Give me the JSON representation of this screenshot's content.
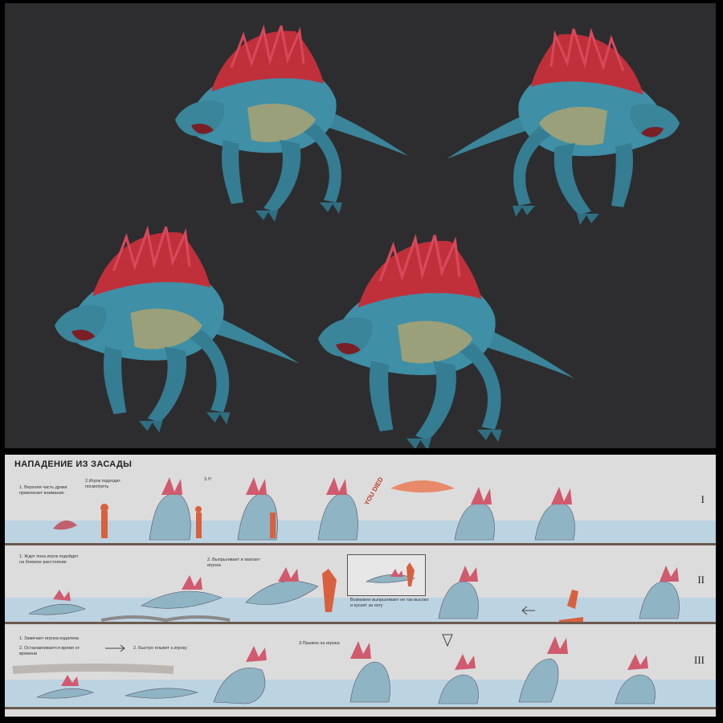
{
  "board": {
    "title": "НАПАДЕНИЕ ИЗ ЗАСАДЫ",
    "rows": [
      {
        "numeral": "I",
        "notes": [
          "1. Верхняя часть драки привлекает внимание",
          "2.Игрок подходит посмотреть",
          "3.!!!",
          "YOU DIED"
        ]
      },
      {
        "numeral": "II",
        "notes": [
          "1. Ждет пока игрок подойдет на близкое расстояние",
          "2. Выпрыгивает и хватает игрока",
          "Возможно выпрыгивает не так высоко и кусает за ногу"
        ]
      },
      {
        "numeral": "III",
        "notes": [
          "1. Замечает игрока издалека",
          "2. Останавливается время от времени",
          "2. Быстро плывет к игроку",
          "3.Прыжок на игрока"
        ]
      }
    ]
  },
  "colors": {
    "render_bg": "#2d2d2f",
    "creature_body": "#3f8fa6",
    "creature_crest": "#c0303a",
    "creature_belly": "#9aa07a",
    "board_bg": "#dcdcdc",
    "water": "#bcd3e2",
    "player": "#d9603f"
  }
}
